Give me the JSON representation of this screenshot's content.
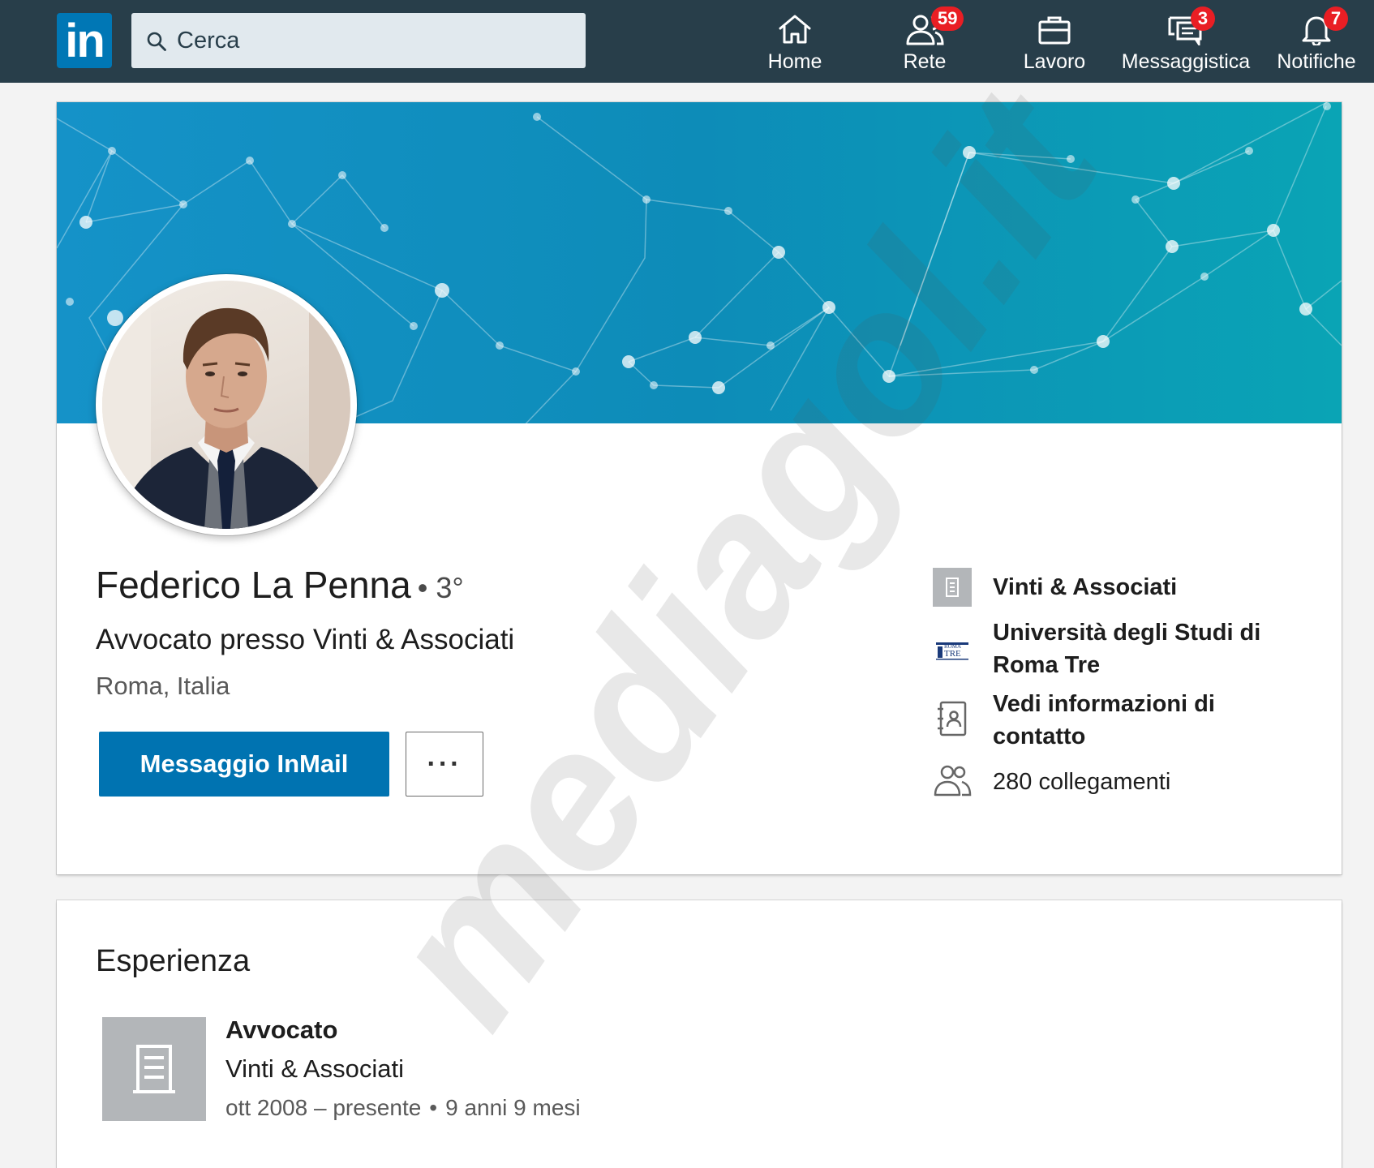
{
  "nav": {
    "logo_text": "in",
    "search_placeholder": "Cerca",
    "items": [
      {
        "label": "Home",
        "badge": ""
      },
      {
        "label": "Rete",
        "badge": "59"
      },
      {
        "label": "Lavoro",
        "badge": ""
      },
      {
        "label": "Messaggistica",
        "badge": "3"
      },
      {
        "label": "Notifiche",
        "badge": "7"
      }
    ]
  },
  "profile": {
    "name": "Federico La Penna",
    "degree": "• 3°",
    "headline": "Avvocato presso Vinti & Associati",
    "location": "Roma, Italia",
    "inmail_button": "Messaggio InMail",
    "more_button": "···",
    "side": {
      "company": "Vinti & Associati",
      "school": "Università degli Studi di Roma Tre",
      "contact": "Vedi informazioni di contatto",
      "connections": "280 collegamenti"
    }
  },
  "experience": {
    "section_title": "Esperienza",
    "items": [
      {
        "title": "Avvocato",
        "company": "Vinti & Associati",
        "dates": "ott 2008 – presente",
        "duration": "9 anni 9 mesi"
      }
    ]
  },
  "watermark": "mediagol.it",
  "colors": {
    "nav_bg": "#283e4a",
    "brand_blue": "#0073b1",
    "badge_red": "#e91e24",
    "banner_start": "#1592c8",
    "banner_end": "#0aa4b5"
  }
}
